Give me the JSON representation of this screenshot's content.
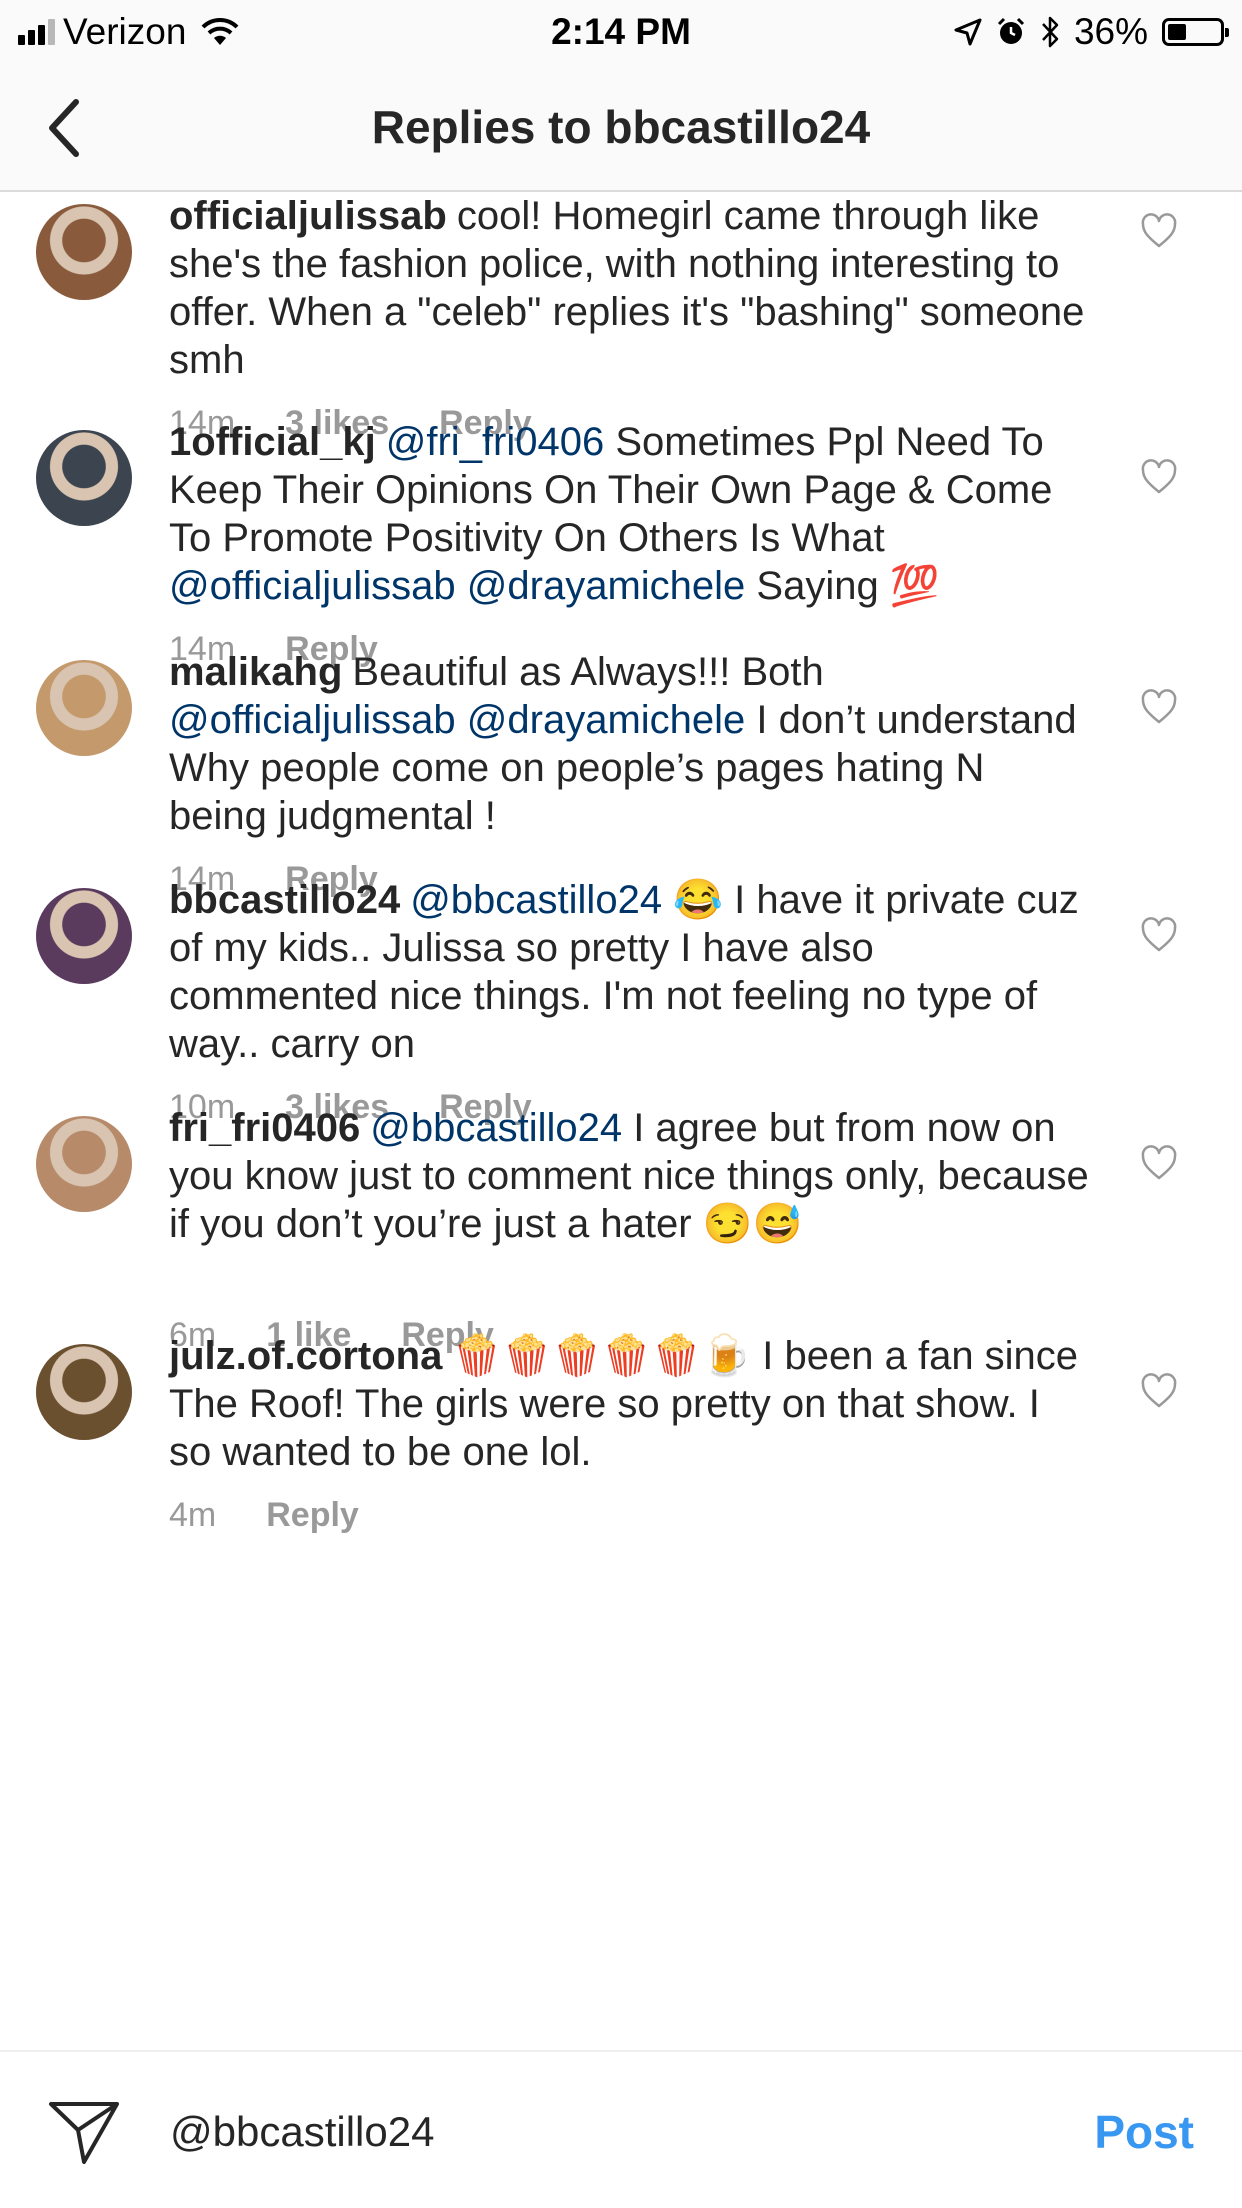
{
  "status_bar": {
    "carrier": "Verizon",
    "time": "2:14 PM",
    "battery_percent": "36%",
    "battery_level": 0.36,
    "icons": [
      "signal-icon",
      "wifi-icon",
      "location-icon",
      "alarm-icon",
      "bluetooth-icon",
      "battery-icon"
    ]
  },
  "header": {
    "title": "Replies to bbcastillo24",
    "back_icon": "chevron-left-icon"
  },
  "comments": [
    {
      "username": "officialjulissab",
      "segments": [
        {
          "text": "cool! Homegirl came through like she's the fashion police, with nothing interesting to offer. When a \"celeb\" replies it's \"bashing\" someone smh",
          "mention": false
        }
      ],
      "time": "14m",
      "likes": "3 likes",
      "reply": "Reply",
      "avatar_color": "#8a5a3c",
      "liked": false
    },
    {
      "username": "1official_kj",
      "segments": [
        {
          "text": "@fri_fri0406",
          "mention": true
        },
        {
          "text": " Sometimes Ppl Need To Keep Their Opinions On Their Own Page & Come To Promote Positivity On Others Is What ",
          "mention": false
        },
        {
          "text": "@officialjulissab",
          "mention": true
        },
        {
          "text": " ",
          "mention": false
        },
        {
          "text": "@drayamichele",
          "mention": true
        },
        {
          "text": "  Saying 💯",
          "mention": false
        }
      ],
      "time": "14m",
      "likes": "",
      "reply": "Reply",
      "avatar_color": "#3c4450",
      "liked": false
    },
    {
      "username": "malikahg",
      "segments": [
        {
          "text": "Beautiful as Always!!! Both ",
          "mention": false
        },
        {
          "text": "@officialjulissab",
          "mention": true
        },
        {
          "text": " ",
          "mention": false
        },
        {
          "text": "@drayamichele",
          "mention": true
        },
        {
          "text": " I don’t understand Why people come on people’s pages hating N being judgmental !",
          "mention": false
        }
      ],
      "time": "14m",
      "likes": "",
      "reply": "Reply",
      "avatar_color": "#c49a6c",
      "liked": false
    },
    {
      "username": "bbcastillo24",
      "segments": [
        {
          "text": "@bbcastillo24",
          "mention": true
        },
        {
          "text": " 😂 I have it private cuz of my kids.. Julissa so pretty I have also commented nice things. I'm not feeling no type of way.. carry on",
          "mention": false
        }
      ],
      "time": "10m",
      "likes": "3 likes",
      "reply": "Reply",
      "avatar_color": "#5a3b5e",
      "liked": false
    },
    {
      "username": "fri_fri0406",
      "segments": [
        {
          "text": "@bbcastillo24",
          "mention": true
        },
        {
          "text": " I agree but from now on you know just to comment nice things only, because if you don’t you’re just a hater 😏😅",
          "mention": false
        }
      ],
      "time": "6m",
      "likes": "1 like",
      "reply": "Reply",
      "avatar_color": "#b78a6a",
      "liked": false
    },
    {
      "username": "julz.of.cortona",
      "segments": [
        {
          "text": "🍿🍿🍿🍿🍿🍺 I been a fan since The Roof! The girls were so pretty on that show. I so wanted to be one lol.",
          "mention": false
        }
      ],
      "time": "4m",
      "likes": "",
      "reply": "Reply",
      "avatar_color": "#6b5030",
      "liked": false
    }
  ],
  "composer": {
    "value": "@bbcastillo24",
    "post_label": "Post",
    "send_icon": "paper-plane-icon"
  },
  "colors": {
    "mention": "#003569",
    "post_button": "#3897f0",
    "meta_text": "#999999"
  }
}
